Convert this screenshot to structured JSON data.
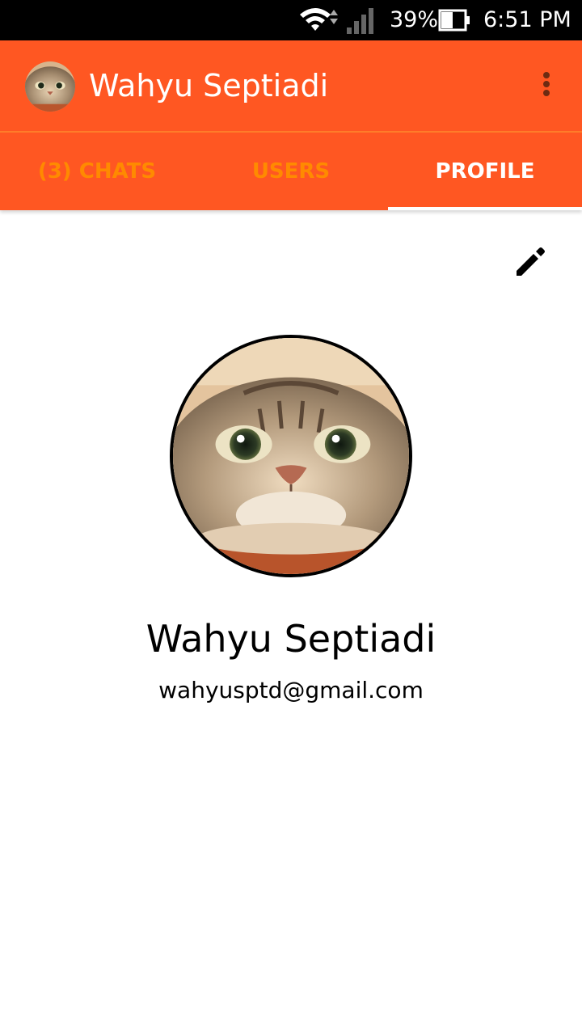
{
  "status_bar": {
    "battery_percent": "39%",
    "time": "6:51 PM",
    "battery_level": 0.39,
    "icons": [
      "wifi-icon",
      "signal-icon",
      "battery-icon"
    ]
  },
  "app_bar": {
    "title": "Wahyu Septiadi",
    "color": "#ff5722",
    "avatar_icon": "cat-avatar",
    "menu_icon": "more-vert-icon"
  },
  "tabs": [
    {
      "label": "(3) CHATS",
      "selected": false
    },
    {
      "label": "USERS",
      "selected": false
    },
    {
      "label": "PROFILE",
      "selected": true
    }
  ],
  "colors": {
    "accent": "#ff5722",
    "tab_inactive": "#ff8a00",
    "tab_active": "#ffffff"
  },
  "profile": {
    "name": "Wahyu Septiadi",
    "email": "wahyusptd@gmail.com",
    "edit_icon": "pencil-icon"
  }
}
